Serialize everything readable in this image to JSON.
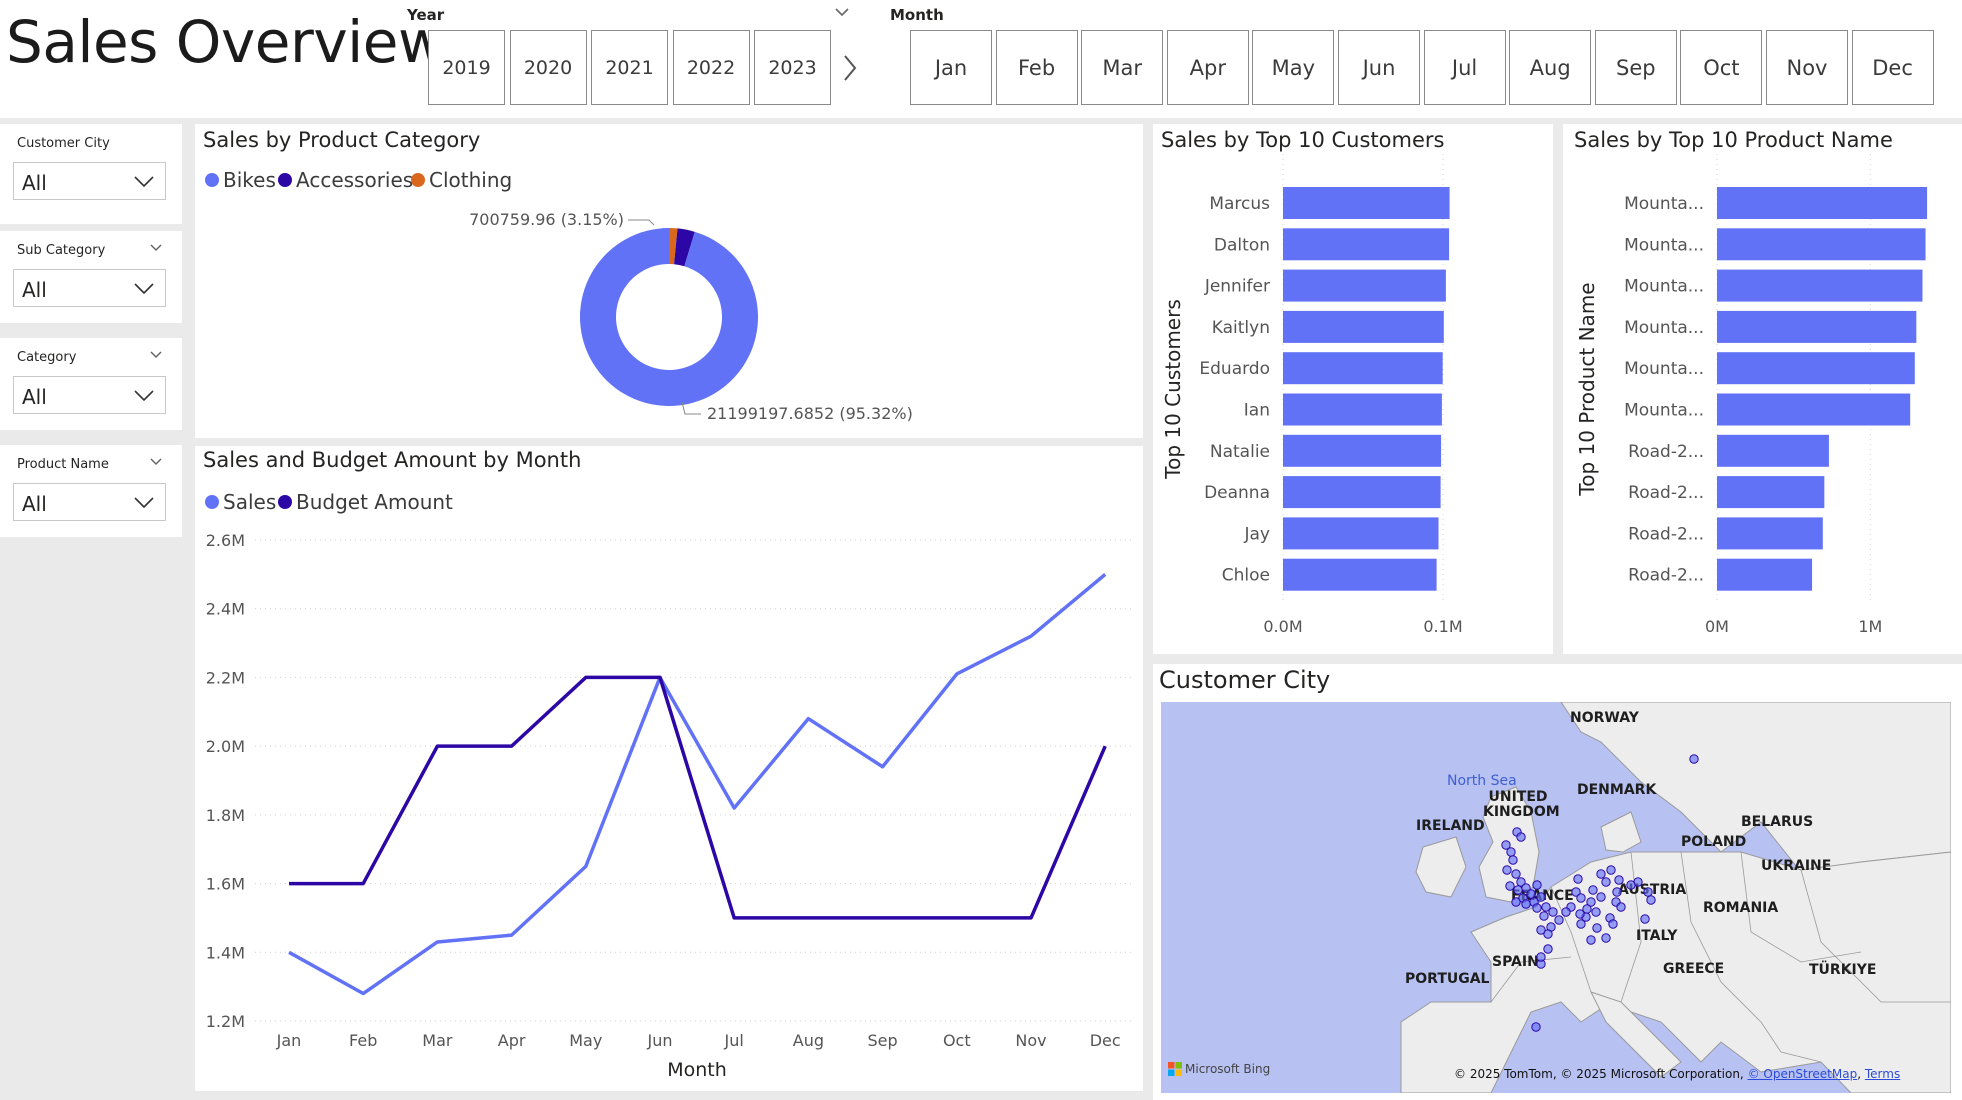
{
  "header": {
    "title": "Sales Overview"
  },
  "year_slicer": {
    "label": "Year",
    "options": [
      "2019",
      "2020",
      "2021",
      "2022",
      "2023"
    ]
  },
  "month_slicer": {
    "label": "Month",
    "options": [
      "Jan",
      "Feb",
      "Mar",
      "Apr",
      "May",
      "Jun",
      "Jul",
      "Aug",
      "Sep",
      "Oct",
      "Nov",
      "Dec"
    ]
  },
  "side_slicers": [
    {
      "label": "Customer City",
      "value": "All"
    },
    {
      "label": "Sub Category",
      "value": "All"
    },
    {
      "label": "Category",
      "value": "All"
    },
    {
      "label": "Product Name",
      "value": "All"
    }
  ],
  "colors": {
    "primary": "#6272f7",
    "secondary": "#2c07a5",
    "tertiary": "#d9681d"
  },
  "chart_data": [
    {
      "type": "pie",
      "title": "Sales by Product Category",
      "categories": [
        "Bikes",
        "Accessories",
        "Clothing"
      ],
      "values": [
        21199197.6852,
        700759.96,
        339000
      ],
      "data_labels": [
        "700759.96 (3.15%)",
        "21199197.6852 (95.32%)"
      ],
      "legend": "top-left"
    },
    {
      "type": "line",
      "title": "Sales and Budget Amount by Month",
      "xlabel": "Month",
      "x": [
        "Jan",
        "Feb",
        "Mar",
        "Apr",
        "May",
        "Jun",
        "Jul",
        "Aug",
        "Sep",
        "Oct",
        "Nov",
        "Dec"
      ],
      "series": [
        {
          "name": "Sales",
          "values": [
            1.4,
            1.28,
            1.43,
            1.45,
            1.65,
            2.2,
            1.82,
            2.08,
            1.94,
            2.21,
            2.32,
            2.5
          ]
        },
        {
          "name": "Budget Amount",
          "values": [
            1.6,
            1.6,
            2.0,
            2.0,
            2.2,
            2.2,
            1.5,
            1.5,
            1.5,
            1.5,
            1.5,
            2.0
          ]
        }
      ],
      "y_unit": "M",
      "ylim": [
        1.2,
        2.6
      ],
      "yticks": [
        "1.2M",
        "1.4M",
        "1.6M",
        "1.8M",
        "2.0M",
        "2.2M",
        "2.4M",
        "2.6M"
      ],
      "grid": true,
      "legend": "top-left"
    },
    {
      "type": "bar",
      "orientation": "horizontal",
      "title": "Sales by Top 10 Customers",
      "ylabel": "Top 10 Customers",
      "categories": [
        "Marcus",
        "Dalton",
        "Jennifer",
        "Kaitlyn",
        "Eduardo",
        "Ian",
        "Natalie",
        "Deanna",
        "Jay",
        "Chloe"
      ],
      "values": [
        0.1041,
        0.1038,
        0.1018,
        0.1005,
        0.0998,
        0.0993,
        0.0988,
        0.0985,
        0.0972,
        0.096
      ],
      "xlim": [
        0,
        0.13
      ],
      "xticks": [
        {
          "v": 0,
          "label": "0.0M"
        },
        {
          "v": 0.1,
          "label": "0.1M"
        }
      ]
    },
    {
      "type": "bar",
      "orientation": "horizontal",
      "title": "Sales by Top 10 Product Name",
      "ylabel": "Top 10 Product Name",
      "categories": [
        "Mounta...",
        "Mounta...",
        "Mounta...",
        "Mounta...",
        "Mounta...",
        "Mounta...",
        "Road-2...",
        "Road-2...",
        "Road-2...",
        "Road-2..."
      ],
      "values": [
        1.37,
        1.36,
        1.34,
        1.3,
        1.29,
        1.26,
        0.73,
        0.7,
        0.69,
        0.62
      ],
      "xlim": [
        0,
        1.35
      ],
      "xticks": [
        {
          "v": 0,
          "label": "0M"
        },
        {
          "v": 1,
          "label": "1M"
        }
      ]
    }
  ],
  "map": {
    "title": "Customer City",
    "countries": [
      "NORWAY",
      "DENMARK",
      "UNITED KINGDOM",
      "IRELAND",
      "BELARUS",
      "POLAND",
      "UKRAINE",
      "FRANCE",
      "AUSTRIA",
      "ROMANIA",
      "ITALY",
      "SPAIN",
      "PORTUGAL",
      "GREECE",
      "TÜRKIYE"
    ],
    "sea_label": "North Sea",
    "attribution": "© 2025 TomTom, © 2025 Microsoft Corporation,",
    "osm_link": "© OpenStreetMap",
    "terms_link": "Terms",
    "logo_text": "Microsoft Bing"
  }
}
